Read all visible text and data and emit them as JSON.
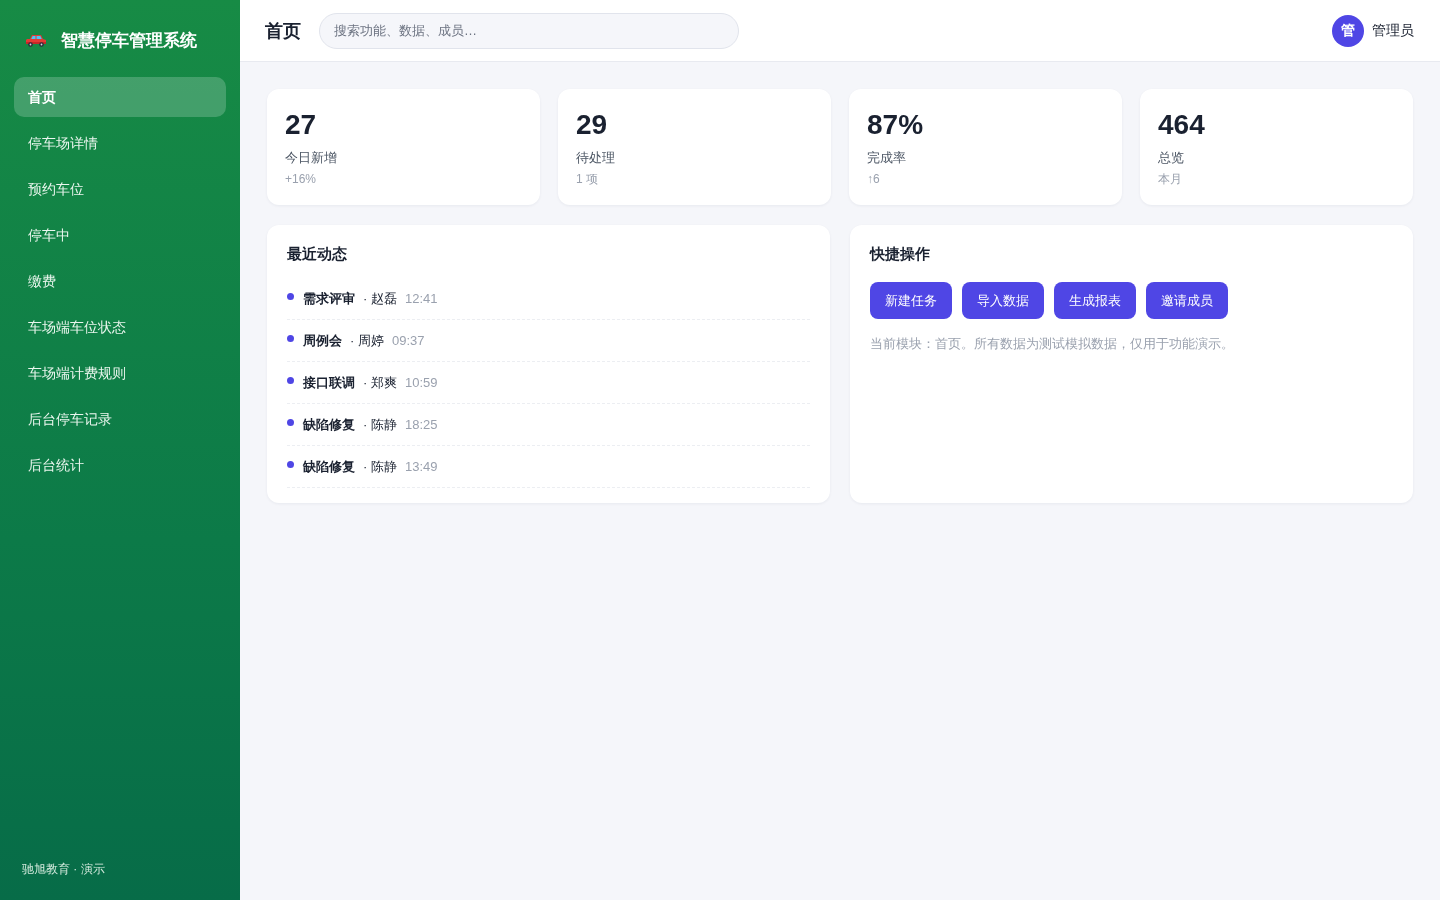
{
  "sidebar": {
    "title": "智慧停车管理系统",
    "items": [
      {
        "label": "首页",
        "selected": true
      },
      {
        "label": "停车场详情",
        "selected": false
      },
      {
        "label": "预约车位",
        "selected": false
      },
      {
        "label": "停车中",
        "selected": false
      },
      {
        "label": "缴费",
        "selected": false
      },
      {
        "label": "车场端车位状态",
        "selected": false
      },
      {
        "label": "车场端计费规则",
        "selected": false
      },
      {
        "label": "后台停车记录",
        "selected": false
      },
      {
        "label": "后台统计",
        "selected": false
      }
    ],
    "footer": "驰旭教育 · 演示"
  },
  "header": {
    "title": "首页",
    "search": {
      "placeholder": "搜索功能、数据、成员…"
    },
    "user": {
      "avatar": "管",
      "name": "管理员"
    }
  },
  "stats": [
    {
      "value": "27",
      "label": "今日新增",
      "sub": "+16%"
    },
    {
      "value": "29",
      "label": "待处理",
      "sub": "1 项"
    },
    {
      "value": "87%",
      "label": "完成率",
      "sub": "↑6"
    },
    {
      "value": "464",
      "label": "总览",
      "sub": "本月"
    }
  ],
  "activity": {
    "title": "最近动态",
    "items": [
      {
        "title": "需求评审",
        "person": "· 赵磊",
        "time": "12:41"
      },
      {
        "title": "周例会",
        "person": "· 周婷",
        "time": "09:37"
      },
      {
        "title": "接口联调",
        "person": "· 郑爽",
        "time": "10:59"
      },
      {
        "title": "缺陷修复",
        "person": "· 陈静",
        "time": "18:25"
      },
      {
        "title": "缺陷修复",
        "person": "· 陈静",
        "time": "13:49"
      }
    ]
  },
  "quick_actions": {
    "title": "快捷操作",
    "buttons": [
      "新建任务",
      "导入数据",
      "生成报表",
      "邀请成员"
    ],
    "note": "当前模块：首页。所有数据为测试模拟数据，仅用于功能演示。"
  }
}
